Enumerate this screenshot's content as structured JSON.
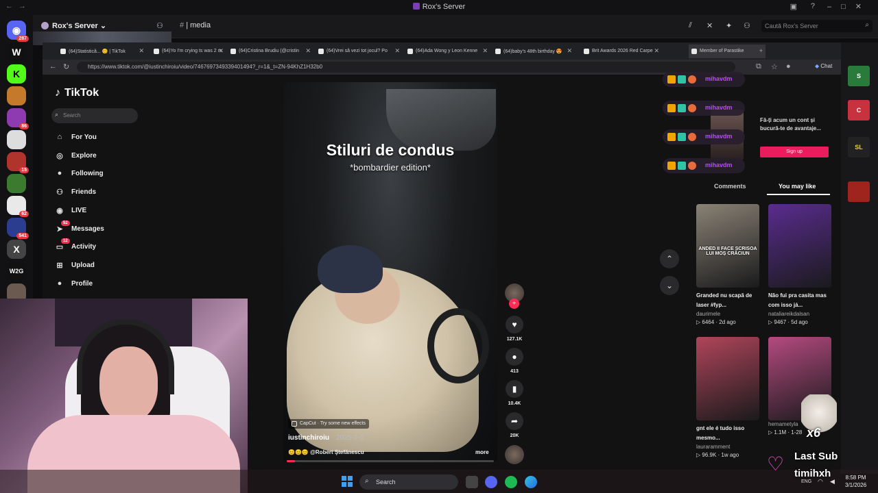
{
  "discord": {
    "window_title": "Rox's Server",
    "server_name": "Rox's Server",
    "channel_name": "| media",
    "search_placeholder": "Caută Rox's Server",
    "server_badges": [
      "287",
      "86",
      "15",
      "62",
      "541"
    ]
  },
  "browser": {
    "tabs": [
      "(64)Statistică... 😊 | TikTok",
      "(64)Yo I'm crying ts was 2 m",
      "(64)Cristina Brudiu (@cristin",
      "(64)Vrei să vezi tot jocul? Po",
      "(64)Ada Wong y Leon Kenne",
      "(64)baby's 48th birthday 😍",
      "Brit Awards 2026 Red Carpe",
      "Member of Parastike"
    ],
    "url": "https://www.tiktok.com/@iustinchiroiu/video/7467697349339401494?_r=1&_t=ZN-94KhZ1H32b0",
    "chat_label": "Chat"
  },
  "tiktok": {
    "logo": "TikTok",
    "search_placeholder": "Search",
    "nav": [
      {
        "label": "For You",
        "icon": "home-icon",
        "glyph": "⌂",
        "badge": ""
      },
      {
        "label": "Explore",
        "icon": "compass-icon",
        "glyph": "◎",
        "badge": ""
      },
      {
        "label": "Following",
        "icon": "following-icon",
        "glyph": "●",
        "badge": ""
      },
      {
        "label": "Friends",
        "icon": "friends-icon",
        "glyph": "⚇",
        "badge": ""
      },
      {
        "label": "LIVE",
        "icon": "live-icon",
        "glyph": "◉",
        "badge": ""
      },
      {
        "label": "Messages",
        "icon": "messages-icon",
        "glyph": "➤",
        "badge": "52"
      },
      {
        "label": "Activity",
        "icon": "activity-icon",
        "glyph": "▭",
        "badge": "12"
      },
      {
        "label": "Upload",
        "icon": "upload-icon",
        "glyph": "⊞",
        "badge": ""
      },
      {
        "label": "Profile",
        "icon": "profile-icon",
        "glyph": "●",
        "badge": ""
      }
    ],
    "video": {
      "title": "Stiluri de condus",
      "subtitle": "*bombardier edition*",
      "capcut": "CapCut · Try some new effects",
      "author": "iustinchiroiu",
      "date": "· 2025-2-5",
      "music": "😊😊😊 @Robert Ştefănescu",
      "more": "more",
      "progress": 0.04
    },
    "actions": {
      "likes": "127.1K",
      "comments": "413",
      "saves": "10.4K",
      "shares": "20K"
    },
    "panel": {
      "tab_comments": "Comments",
      "tab_you_may_like": "You may like",
      "ad_text": "Fă-ți acum un cont și bucură-te de avantaje...",
      "ad_button": "Sign up",
      "cards": [
        {
          "caption": "Granded nu scapă de laser #fyp...",
          "user": "daurimele",
          "meta": "▷ 6464 · 2d ago",
          "overlay": "ANDED II FACE SCRISOA LUI MOȘ CRĂCIUN",
          "color": "#8a8275"
        },
        {
          "caption": "Não fui pra casita mas com isso já...",
          "user": "nataliareikdalsan",
          "meta": "▷ 9467 · 5d ago",
          "overlay": "",
          "color": "#5a2c8f"
        },
        {
          "caption": "gnt ele é tudo isso mesmo...",
          "user": "lauraramment",
          "meta": "▷ 96.9K · 1w ago",
          "overlay": "",
          "color": "#b0455a"
        },
        {
          "caption": "",
          "user": "hemametyla",
          "meta": "▷ 1.1M · 1-28",
          "overlay": "",
          "color": "#b54a80"
        }
      ]
    }
  },
  "chat_overlay": {
    "user": "mihavdm",
    "rows": 4
  },
  "stream": {
    "last_sub_label": "Last Sub",
    "last_sub_name": "timihxh",
    "multiplier": "x6"
  },
  "taskbar": {
    "search": "Search",
    "lang": "ENG",
    "time": "8:58 PM",
    "date": "3/1/2026"
  }
}
